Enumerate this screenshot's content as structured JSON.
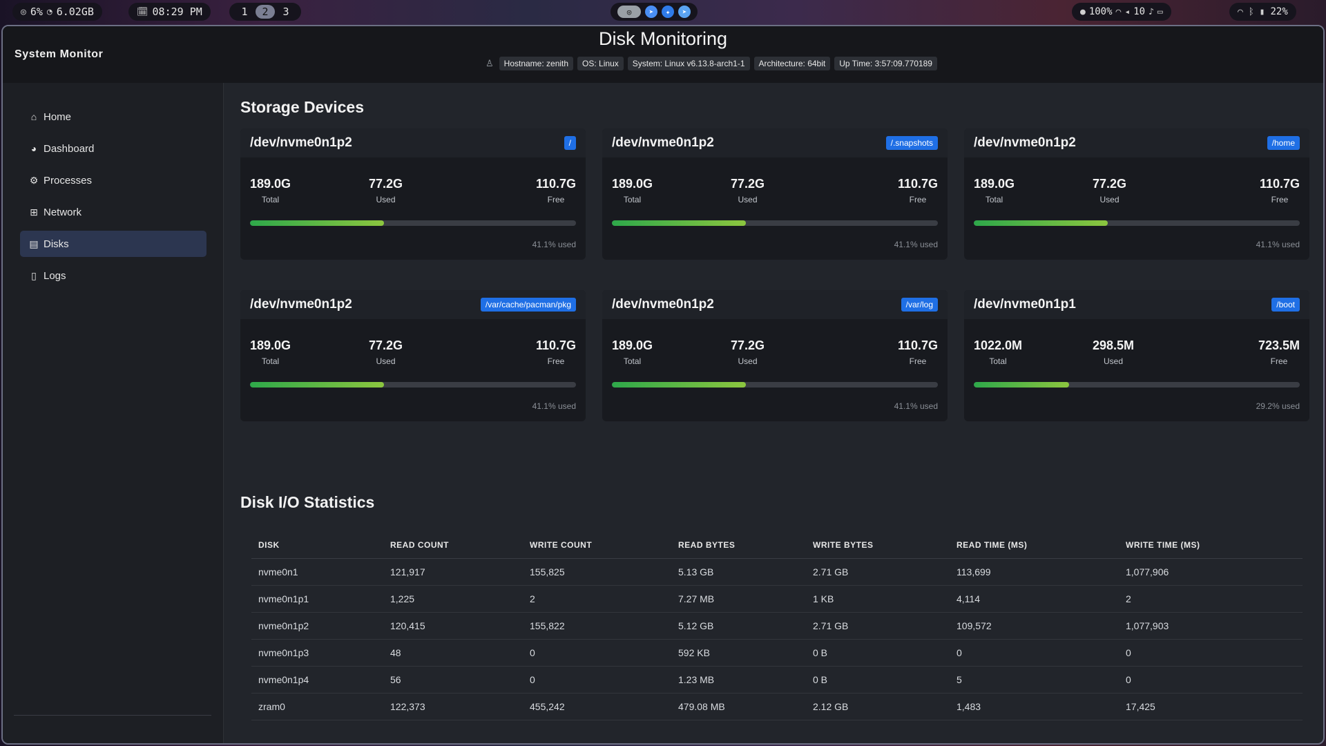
{
  "topbar": {
    "cpu": "6%",
    "memory": "6.02GB",
    "clock": "08:29 PM",
    "workspaces": [
      "1",
      "2",
      "3"
    ],
    "active_workspace": "2",
    "volume": "100%",
    "brightness": "10",
    "battery": "22%"
  },
  "app": {
    "title": "System Monitor",
    "page_title": "Disk Monitoring",
    "sysinfo": [
      "Hostname: zenith",
      "OS: Linux",
      "System: Linux v6.13.8-arch1-1",
      "Architecture: 64bit",
      "Up Time: 3:57:09.770189"
    ]
  },
  "sidebar": {
    "items": [
      {
        "label": "Home",
        "icon": "home-icon"
      },
      {
        "label": "Dashboard",
        "icon": "dashboard-icon"
      },
      {
        "label": "Processes",
        "icon": "processes-icon"
      },
      {
        "label": "Network",
        "icon": "network-icon"
      },
      {
        "label": "Disks",
        "icon": "disks-icon",
        "active": true
      },
      {
        "label": "Logs",
        "icon": "logs-icon"
      }
    ]
  },
  "storage": {
    "title": "Storage Devices",
    "total_label": "Total",
    "used_label": "Used",
    "free_label": "Free",
    "devices": [
      {
        "device": "/dev/nvme0n1p2",
        "mount": "/",
        "total": "189.0G",
        "used": "77.2G",
        "free": "110.7G",
        "percent": 41.1,
        "percent_text": "41.1% used"
      },
      {
        "device": "/dev/nvme0n1p2",
        "mount": "/.snapshots",
        "total": "189.0G",
        "used": "77.2G",
        "free": "110.7G",
        "percent": 41.1,
        "percent_text": "41.1% used"
      },
      {
        "device": "/dev/nvme0n1p2",
        "mount": "/home",
        "total": "189.0G",
        "used": "77.2G",
        "free": "110.7G",
        "percent": 41.1,
        "percent_text": "41.1% used"
      },
      {
        "device": "/dev/nvme0n1p2",
        "mount": "/var/cache/pacman/pkg",
        "total": "189.0G",
        "used": "77.2G",
        "free": "110.7G",
        "percent": 41.1,
        "percent_text": "41.1% used"
      },
      {
        "device": "/dev/nvme0n1p2",
        "mount": "/var/log",
        "total": "189.0G",
        "used": "77.2G",
        "free": "110.7G",
        "percent": 41.1,
        "percent_text": "41.1% used"
      },
      {
        "device": "/dev/nvme0n1p1",
        "mount": "/boot",
        "total": "1022.0M",
        "used": "298.5M",
        "free": "723.5M",
        "percent": 29.2,
        "percent_text": "29.2% used"
      }
    ]
  },
  "io": {
    "title": "Disk I/O Statistics",
    "columns": [
      "DISK",
      "READ COUNT",
      "WRITE COUNT",
      "READ BYTES",
      "WRITE BYTES",
      "READ TIME (MS)",
      "WRITE TIME (MS)"
    ],
    "rows": [
      [
        "nvme0n1",
        "121,917",
        "155,825",
        "5.13 GB",
        "2.71 GB",
        "113,699",
        "1,077,906"
      ],
      [
        "nvme0n1p1",
        "1,225",
        "2",
        "7.27 MB",
        "1 KB",
        "4,114",
        "2"
      ],
      [
        "nvme0n1p2",
        "120,415",
        "155,822",
        "5.12 GB",
        "2.71 GB",
        "109,572",
        "1,077,903"
      ],
      [
        "nvme0n1p3",
        "48",
        "0",
        "592 KB",
        "0 B",
        "0",
        "0"
      ],
      [
        "nvme0n1p4",
        "56",
        "0",
        "1.23 MB",
        "0 B",
        "5",
        "0"
      ],
      [
        "zram0",
        "122,373",
        "455,242",
        "479.08 MB",
        "2.12 GB",
        "1,483",
        "17,425"
      ]
    ]
  }
}
